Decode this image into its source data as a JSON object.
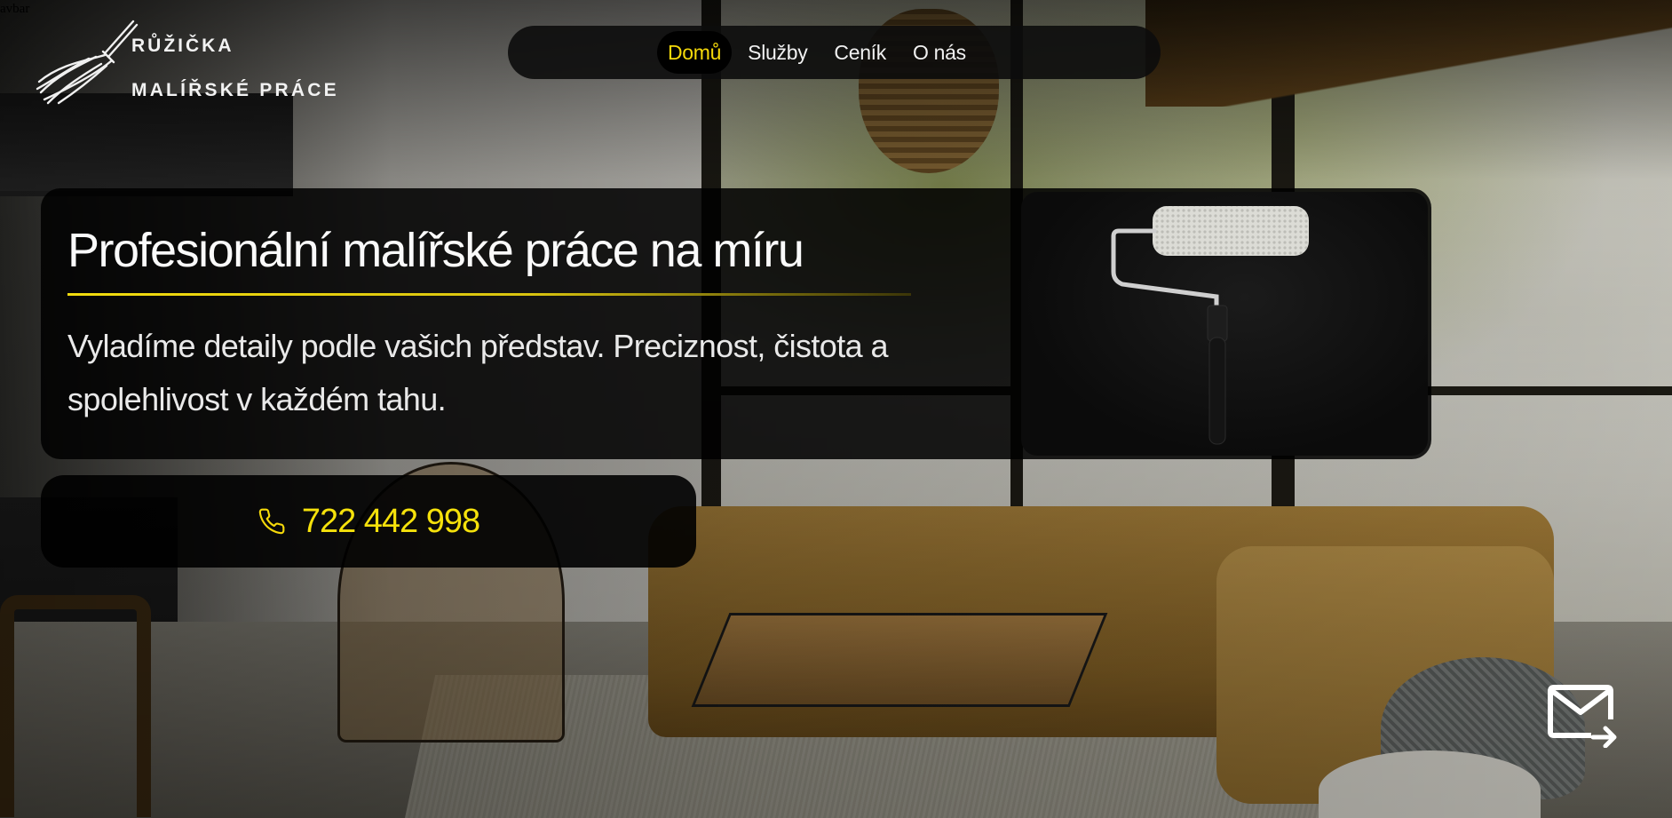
{
  "page": {
    "stray_label": "avbar"
  },
  "logo": {
    "line1": "RŮŽIČKA",
    "line2": "MALÍŘSKÉ PRÁCE",
    "icon": "paint-brush-icon"
  },
  "nav": {
    "items": [
      {
        "label": "Domů",
        "active": true
      },
      {
        "label": "Služby",
        "active": false
      },
      {
        "label": "Ceník",
        "active": false
      },
      {
        "label": "O nás",
        "active": false
      }
    ]
  },
  "hero": {
    "title": "Profesionální malířské práce na míru",
    "subtitle": "Vyladíme detaily podle vašich představ. Preciznost, čistota a spolehlivost v každém tahu.",
    "image": "paint-roller"
  },
  "contact": {
    "phone": "722 442 998",
    "phone_icon": "phone-icon",
    "mail_icon": "mail-send-icon"
  },
  "colors": {
    "accent": "#f5d90a",
    "panel": "#000000",
    "text": "#ffffff"
  }
}
